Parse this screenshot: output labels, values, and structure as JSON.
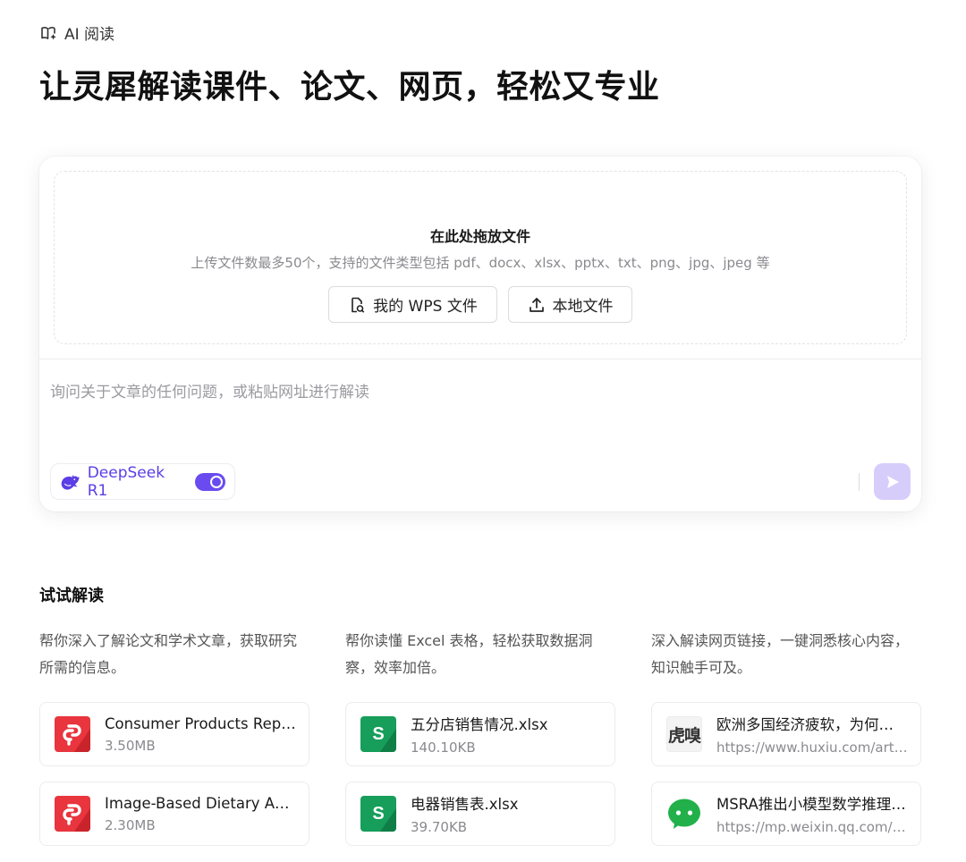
{
  "breadcrumb": {
    "label": "AI 阅读",
    "icon": "book-ai-icon"
  },
  "headline": "让灵犀解读课件、论文、网页，轻松又专业",
  "upload": {
    "title": "在此处拖放文件",
    "subtitle": "上传文件数最多50个，支持的文件类型包括 pdf、docx、xlsx、pptx、txt、png、jpg、jpeg 等",
    "wps_button": "我的 WPS 文件",
    "local_button": "本地文件"
  },
  "ask": {
    "placeholder": "询问关于文章的任何问题，或粘贴网址进行解读"
  },
  "model": {
    "name": "DeepSeek R1",
    "enabled": true,
    "accent": "#5b3ee6"
  },
  "try": {
    "title": "试试解读",
    "columns": [
      {
        "desc": "帮你深入了解论文和学术文章，获取研究所需的信息。",
        "items": [
          {
            "name": "Consumer Products Report...",
            "meta": "3.50MB",
            "icon": "pdf-icon"
          },
          {
            "name": "Image-Based Dietary Assessment...",
            "meta": "2.30MB",
            "icon": "pdf-icon"
          }
        ]
      },
      {
        "desc": "帮你读懂 Excel 表格，轻松获取数据洞察，效率加倍。",
        "items": [
          {
            "name": "五分店销售情况.xlsx",
            "meta": "140.10KB",
            "icon": "spreadsheet-icon"
          },
          {
            "name": "电器销售表.xlsx",
            "meta": "39.70KB",
            "icon": "spreadsheet-icon"
          }
        ]
      },
      {
        "desc": "深入解读网页链接，一键洞悉核心内容，知识触手可及。",
        "items": [
          {
            "name": "欧洲多国经济疲软，为何西班牙...",
            "meta": "https://www.huxiu.com/article/...",
            "icon": "huxiu-logo-icon",
            "logo_text": "虎嗅"
          },
          {
            "name": "MSRA推出小模型数学推理新方法...",
            "meta": "https://mp.weixin.qq.com/s/...",
            "icon": "wechat-icon"
          }
        ]
      }
    ]
  },
  "colors": {
    "pdf": "#e8353e",
    "spreadsheet": "#169e5a",
    "accent": "#6a4bf0",
    "send_disabled": "#d7cdfb"
  }
}
